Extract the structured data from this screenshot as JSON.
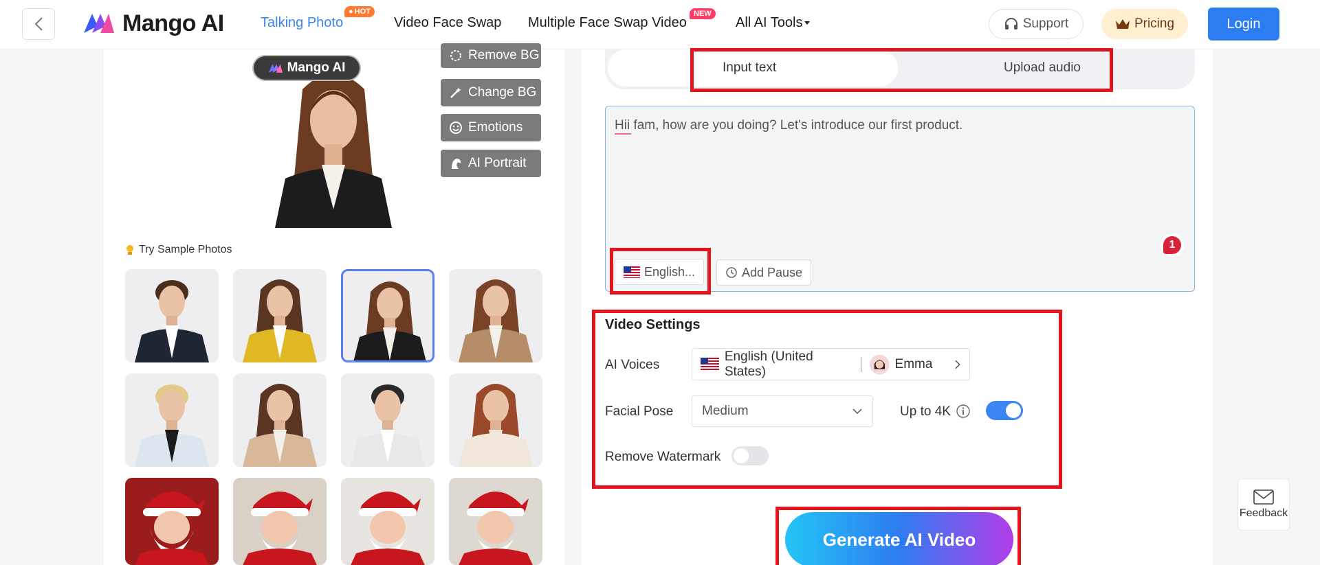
{
  "header": {
    "logo_text": "Mango AI",
    "nav": [
      {
        "label": "Talking Photo",
        "badge": "HOT"
      },
      {
        "label": "Video Face Swap"
      },
      {
        "label": "Multiple Face Swap Video",
        "badge": "NEW"
      },
      {
        "label": "All AI Tools"
      }
    ],
    "support_label": "Support",
    "pricing_label": "Pricing",
    "login_label": "Login"
  },
  "preview": {
    "watermark_label": "Mango AI",
    "tools": [
      "Remove BG",
      "Change BG",
      "Emotions",
      "AI Portrait"
    ]
  },
  "samples": {
    "title": "Try Sample Photos",
    "selected_index": 2
  },
  "input": {
    "tabs": [
      "Input text",
      "Upload audio"
    ],
    "active_tab": "Input text",
    "text": "Hii fam, how are you doing? Let's introduce our first product.",
    "language_label": "English...",
    "add_pause_label": "Add Pause",
    "count": "1"
  },
  "video_settings": {
    "title": "Video Settings",
    "voices_label": "AI Voices",
    "voice_language": "English (United States)",
    "voice_name": "Emma",
    "pose_label": "Facial Pose",
    "pose_value": "Medium",
    "upscale_label": "Up to 4K",
    "upscale_on": true,
    "watermark_label": "Remove Watermark",
    "watermark_on": false
  },
  "generate_label": "Generate AI Video",
  "feedback_label": "Feedback",
  "colors": {
    "accent": "#2c7df2",
    "highlight": "#e3141c"
  }
}
